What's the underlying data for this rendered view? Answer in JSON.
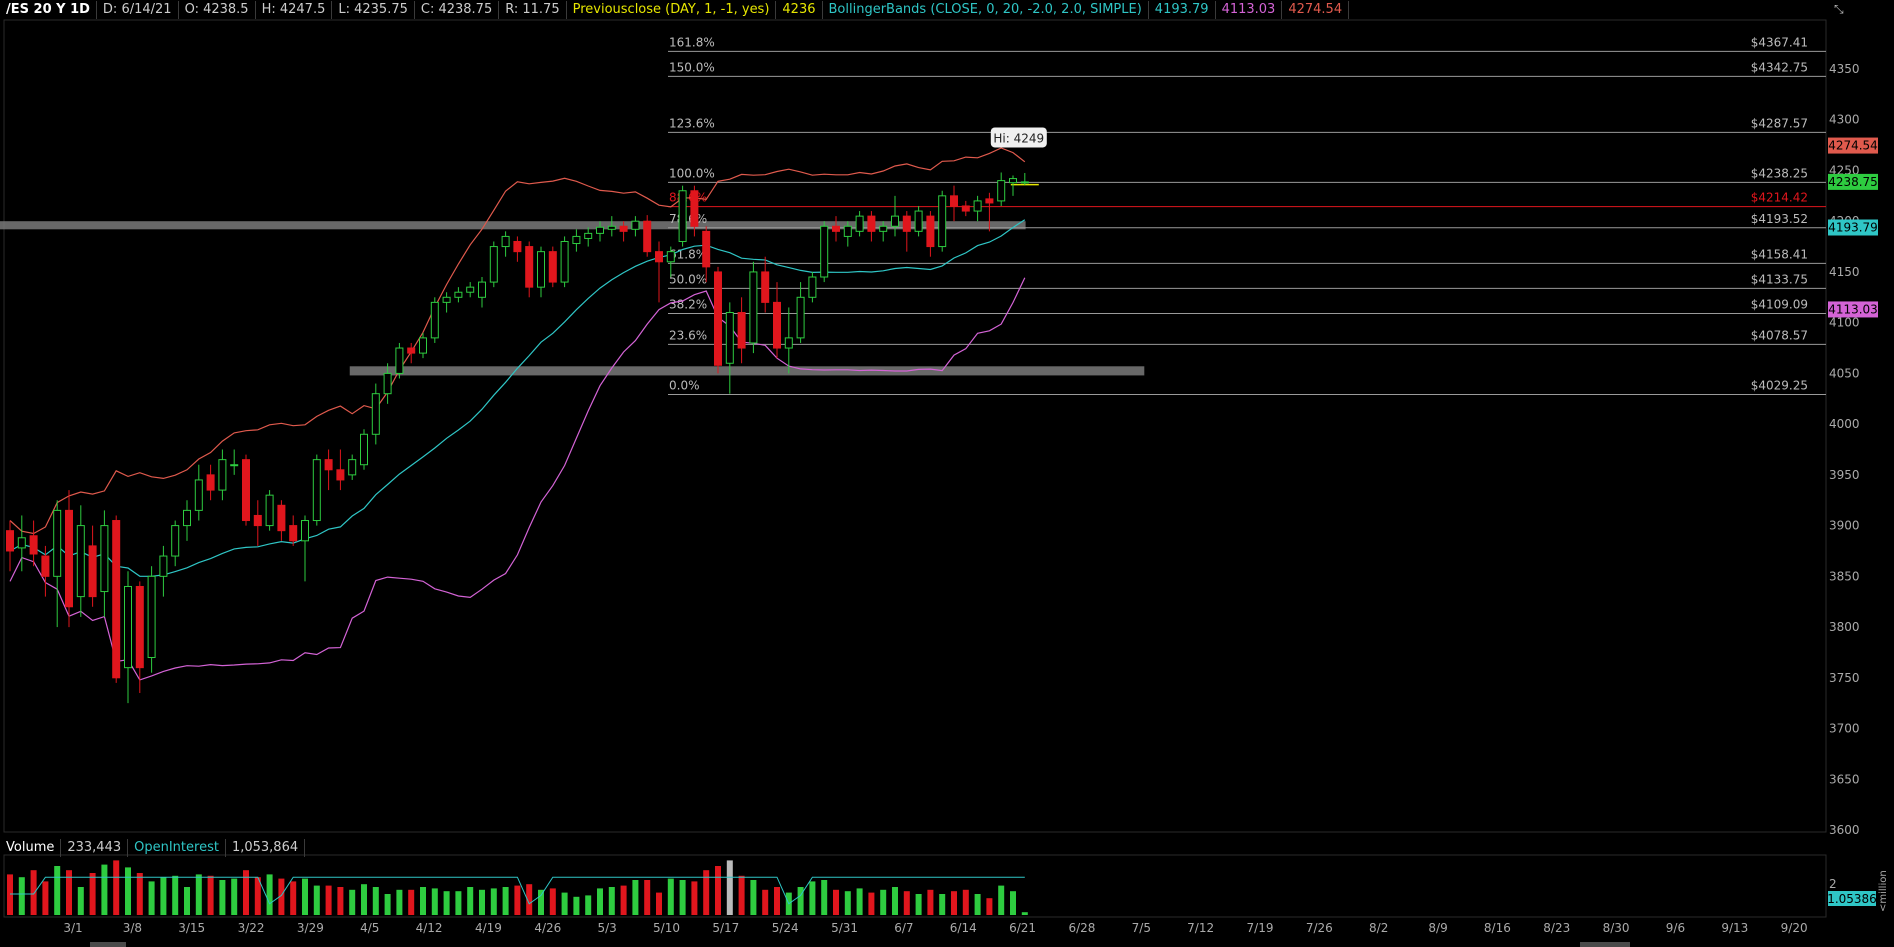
{
  "header": {
    "symbol": "/ES 20 Y 1D",
    "date": "D: 6/14/21",
    "open": "O: 4238.5",
    "high": "H: 4247.5",
    "low": "L: 4235.75",
    "close": "C: 4238.75",
    "range": "R: 11.75",
    "prevclose_label": "Previousclose (DAY, 1, -1, yes)",
    "prevclose_value": "4236",
    "bb_label": "BollingerBands (CLOSE, 0, 20, -2.0, 2.0, SIMPLE)",
    "bb_mid": "4193.79",
    "bb_lower": "4113.03",
    "bb_upper": "4274.54"
  },
  "volume_header": {
    "volume_label": "Volume",
    "volume_value": "233,443",
    "oi_label": "OpenInterest",
    "oi_value": "1,053,864"
  },
  "colors": {
    "up": "#2ecc40",
    "down": "#e0161d",
    "bb_mid": "#2fc6c6",
    "bb_upper": "#e05a4d",
    "bb_lower": "#d463d6",
    "prevclose": "#e6e600",
    "fib": "#9a9a9a"
  },
  "chart_data": {
    "type": "candlestick",
    "price_axis": {
      "min": 3600,
      "max": 4350,
      "ticks": [
        "3600",
        "3650",
        "3700",
        "3750",
        "3800",
        "3850",
        "3900",
        "3950",
        "4000",
        "4050",
        "4100",
        "4150",
        "4200",
        "4250",
        "4300",
        "4350"
      ]
    },
    "date_ticks": [
      "3/1",
      "3/8",
      "3/15",
      "3/22",
      "3/29",
      "4/5",
      "4/12",
      "4/19",
      "4/26",
      "5/3",
      "5/10",
      "5/17",
      "5/24",
      "5/31",
      "6/7",
      "6/14",
      "6/21",
      "6/28",
      "7/5",
      "7/12",
      "7/19",
      "7/26",
      "8/2",
      "8/9",
      "8/16",
      "8/23",
      "8/30",
      "9/6",
      "9/13",
      "9/20"
    ],
    "fib_levels": [
      {
        "pct": "161.8%",
        "price": 4367.41,
        "label": "$4367.41"
      },
      {
        "pct": "150.0%",
        "price": 4342.75,
        "label": "$4342.75"
      },
      {
        "pct": "123.6%",
        "price": 4287.57,
        "label": "$4287.57"
      },
      {
        "pct": "100.0%",
        "price": 4238.25,
        "label": "$4238.25"
      },
      {
        "pct": "88.6%",
        "price": 4214.42,
        "label": "$4214.42",
        "highlight": true
      },
      {
        "pct": "78.6%",
        "price": 4193.52,
        "label": "$4193.52"
      },
      {
        "pct": "61.8%",
        "price": 4158.41,
        "label": "$4158.41"
      },
      {
        "pct": "50.0%",
        "price": 4133.75,
        "label": "$4133.75"
      },
      {
        "pct": "38.2%",
        "price": 4109.09,
        "label": "$4109.09"
      },
      {
        "pct": "23.6%",
        "price": 4078.57,
        "label": "$4078.57"
      },
      {
        "pct": "0.0%",
        "price": 4029.25,
        "label": "$4029.25"
      }
    ],
    "zones": [
      {
        "price_top": 4200,
        "price_bottom": 4192,
        "start_date": "4/15",
        "end_date": "6/21"
      },
      {
        "price_top": 4057,
        "price_bottom": 4048,
        "start_date": "4/5",
        "end_date": "7/5"
      }
    ],
    "annotation": "Hi: 4249",
    "price_tags": [
      {
        "value": "4274.54",
        "price": 4274.54,
        "color": "#e05a4d"
      },
      {
        "value": "4238.75",
        "price": 4238.75,
        "color": "#2ecc40"
      },
      {
        "value": "4193.79",
        "price": 4193.79,
        "color": "#2fc6c6"
      },
      {
        "value": "4113.03",
        "price": 4113.03,
        "color": "#d463d6"
      }
    ],
    "volume_axis_tick": "2",
    "oi_tag": "1.05386",
    "volume_units": "<million",
    "candles": [
      [
        3895,
        3905,
        3855,
        3875
      ],
      [
        3878,
        3910,
        3855,
        3888
      ],
      [
        3890,
        3905,
        3860,
        3872
      ],
      [
        3870,
        3880,
        3830,
        3850
      ],
      [
        3850,
        3925,
        3800,
        3915
      ],
      [
        3915,
        3935,
        3800,
        3820
      ],
      [
        3830,
        3920,
        3810,
        3900
      ],
      [
        3880,
        3900,
        3820,
        3830
      ],
      [
        3835,
        3915,
        3810,
        3900
      ],
      [
        3905,
        3910,
        3745,
        3750
      ],
      [
        3760,
        3855,
        3725,
        3840
      ],
      [
        3840,
        3845,
        3735,
        3760
      ],
      [
        3770,
        3860,
        3755,
        3850
      ],
      [
        3850,
        3880,
        3830,
        3870
      ],
      [
        3870,
        3905,
        3860,
        3900
      ],
      [
        3900,
        3925,
        3885,
        3915
      ],
      [
        3915,
        3960,
        3905,
        3945
      ],
      [
        3950,
        3960,
        3925,
        3935
      ],
      [
        3935,
        3975,
        3925,
        3965
      ],
      [
        3960,
        3975,
        3950,
        3960
      ],
      [
        3965,
        3970,
        3900,
        3905
      ],
      [
        3910,
        3925,
        3880,
        3900
      ],
      [
        3900,
        3935,
        3895,
        3930
      ],
      [
        3920,
        3925,
        3885,
        3895
      ],
      [
        3900,
        3910,
        3880,
        3885
      ],
      [
        3885,
        3910,
        3845,
        3905
      ],
      [
        3905,
        3970,
        3900,
        3965
      ],
      [
        3965,
        3975,
        3935,
        3955
      ],
      [
        3955,
        3975,
        3935,
        3945
      ],
      [
        3950,
        3970,
        3945,
        3965
      ],
      [
        3960,
        3995,
        3955,
        3990
      ],
      [
        3990,
        4040,
        3980,
        4030
      ],
      [
        4030,
        4060,
        4020,
        4050
      ],
      [
        4050,
        4080,
        4045,
        4075
      ],
      [
        4075,
        4080,
        4060,
        4070
      ],
      [
        4070,
        4090,
        4065,
        4085
      ],
      [
        4085,
        4125,
        4080,
        4120
      ],
      [
        4120,
        4130,
        4110,
        4125
      ],
      [
        4125,
        4135,
        4120,
        4130
      ],
      [
        4130,
        4140,
        4125,
        4135
      ],
      [
        4125,
        4145,
        4115,
        4140
      ],
      [
        4140,
        4180,
        4135,
        4175
      ],
      [
        4175,
        4190,
        4165,
        4185
      ],
      [
        4180,
        4185,
        4160,
        4170
      ],
      [
        4175,
        4180,
        4125,
        4135
      ],
      [
        4135,
        4175,
        4125,
        4170
      ],
      [
        4170,
        4175,
        4135,
        4140
      ],
      [
        4140,
        4185,
        4135,
        4180
      ],
      [
        4178,
        4192,
        4170,
        4185
      ],
      [
        4183,
        4194,
        4175,
        4188
      ],
      [
        4188,
        4200,
        4180,
        4194
      ],
      [
        4192,
        4205,
        4185,
        4195
      ],
      [
        4195,
        4200,
        4180,
        4190
      ],
      [
        4192,
        4205,
        4185,
        4200
      ],
      [
        4200,
        4206,
        4165,
        4170
      ],
      [
        4170,
        4180,
        4120,
        4160
      ],
      [
        4160,
        4175,
        4145,
        4170
      ],
      [
        4180,
        4235,
        4175,
        4230
      ],
      [
        4230,
        4235,
        4185,
        4195
      ],
      [
        4190,
        4195,
        4140,
        4155
      ],
      [
        4150,
        4155,
        4050,
        4058
      ],
      [
        4060,
        4120,
        4030,
        4110
      ],
      [
        4110,
        4125,
        4060,
        4075
      ],
      [
        4080,
        4160,
        4070,
        4150
      ],
      [
        4150,
        4165,
        4110,
        4120
      ],
      [
        4120,
        4140,
        4065,
        4075
      ],
      [
        4075,
        4115,
        4050,
        4085
      ],
      [
        4085,
        4140,
        4080,
        4125
      ],
      [
        4125,
        4150,
        4120,
        4145
      ],
      [
        4145,
        4200,
        4140,
        4195
      ],
      [
        4195,
        4205,
        4180,
        4190
      ],
      [
        4185,
        4200,
        4175,
        4195
      ],
      [
        4190,
        4210,
        4185,
        4205
      ],
      [
        4205,
        4210,
        4180,
        4190
      ],
      [
        4190,
        4200,
        4180,
        4195
      ],
      [
        4195,
        4225,
        4185,
        4205
      ],
      [
        4205,
        4210,
        4170,
        4190
      ],
      [
        4190,
        4215,
        4185,
        4210
      ],
      [
        4205,
        4210,
        4165,
        4175
      ],
      [
        4175,
        4230,
        4170,
        4225
      ],
      [
        4225,
        4235,
        4200,
        4215
      ],
      [
        4215,
        4220,
        4205,
        4210
      ],
      [
        4210,
        4225,
        4200,
        4220
      ],
      [
        4222,
        4228,
        4190,
        4218
      ],
      [
        4220,
        4248,
        4215,
        4240
      ],
      [
        4238,
        4245,
        4225,
        4242
      ],
      [
        4238.5,
        4247.5,
        4235.75,
        4238.75
      ]
    ],
    "volumes": [
      1.45,
      1.35,
      1.6,
      1.2,
      1.75,
      1.6,
      1.0,
      1.5,
      1.8,
      1.95,
      1.7,
      1.5,
      1.2,
      1.35,
      1.4,
      1.0,
      1.45,
      1.4,
      1.25,
      1.3,
      1.6,
      1.35,
      1.45,
      1.3,
      1.2,
      1.3,
      1.05,
      1.05,
      1.0,
      0.9,
      1.1,
      1.0,
      0.75,
      0.9,
      0.9,
      1.0,
      0.95,
      0.85,
      0.85,
      1.0,
      0.9,
      0.95,
      1.0,
      1.05,
      1.1,
      0.9,
      0.95,
      0.8,
      0.65,
      0.7,
      0.95,
      1.0,
      1.05,
      1.25,
      1.25,
      0.8,
      1.3,
      1.25,
      1.2,
      1.6,
      1.75,
      1.95,
      1.4,
      1.25,
      0.9,
      1.0,
      0.8,
      1.0,
      1.2,
      1.25,
      0.9,
      0.85,
      0.95,
      0.8,
      0.9,
      1.0,
      0.85,
      0.75,
      0.9,
      0.75,
      0.85,
      0.9,
      0.75,
      0.6,
      1.05,
      0.85,
      0.1
    ]
  }
}
